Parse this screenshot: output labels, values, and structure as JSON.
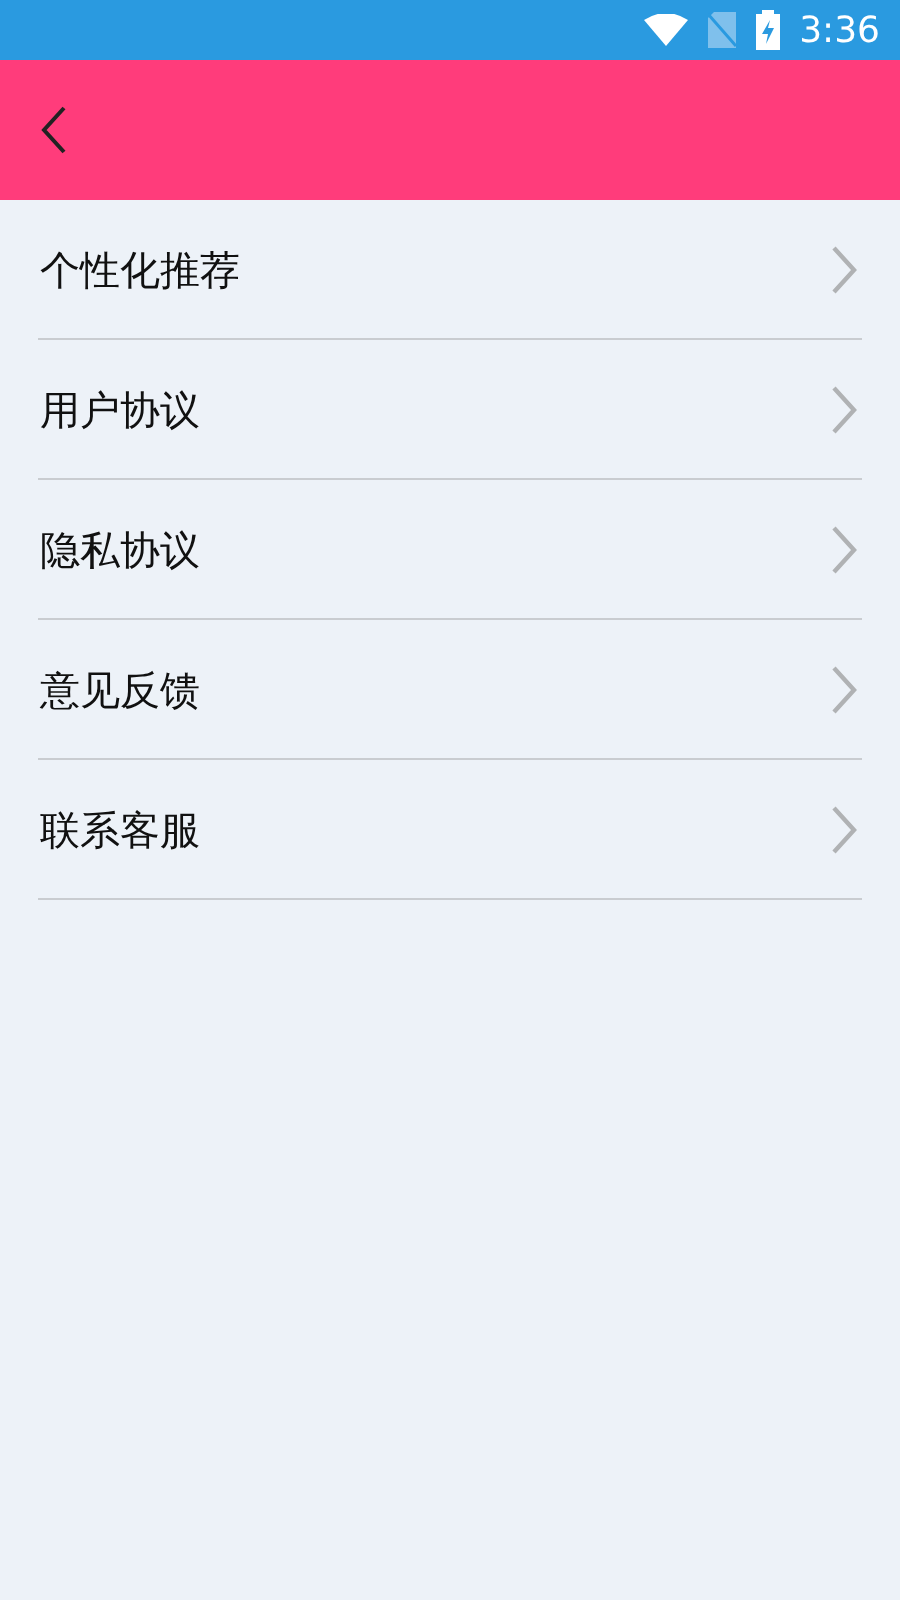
{
  "status_bar": {
    "time": "3:36"
  },
  "menu": [
    {
      "label": "个性化推荐"
    },
    {
      "label": "用户协议"
    },
    {
      "label": "隐私协议"
    },
    {
      "label": "意见反馈"
    },
    {
      "label": "联系客服"
    }
  ]
}
